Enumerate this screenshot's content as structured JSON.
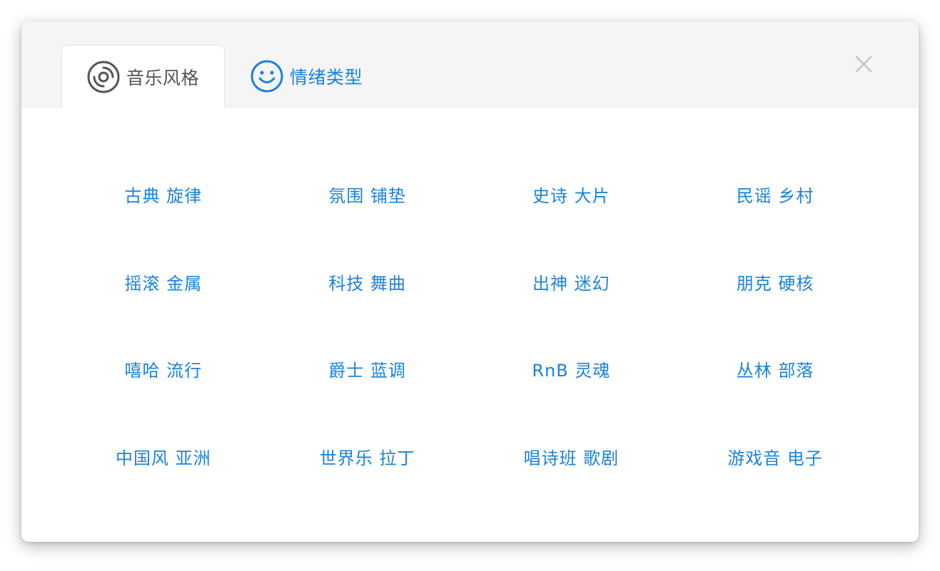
{
  "tabs": [
    {
      "label": "音乐风格",
      "icon": "disc-icon",
      "active": true
    },
    {
      "label": "情绪类型",
      "icon": "smiley-icon",
      "active": false
    }
  ],
  "close_icon": "close-icon",
  "genres": [
    "古典 旋律",
    "氛围 铺垫",
    "史诗 大片",
    "民谣 乡村",
    "摇滚 金属",
    "科技 舞曲",
    "出神 迷幻",
    "朋克 硬核",
    "嘻哈 流行",
    "爵士 蓝调",
    "RnB 灵魂",
    "丛林 部落",
    "中国风 亚洲",
    "世界乐 拉丁",
    "唱诗班 歌剧",
    "游戏音 电子"
  ],
  "colors": {
    "accent": "#1a82e0",
    "tab_active_text": "#555555",
    "tabbar_bg": "#f5f5f5",
    "close_icon": "#c4c4c4"
  }
}
